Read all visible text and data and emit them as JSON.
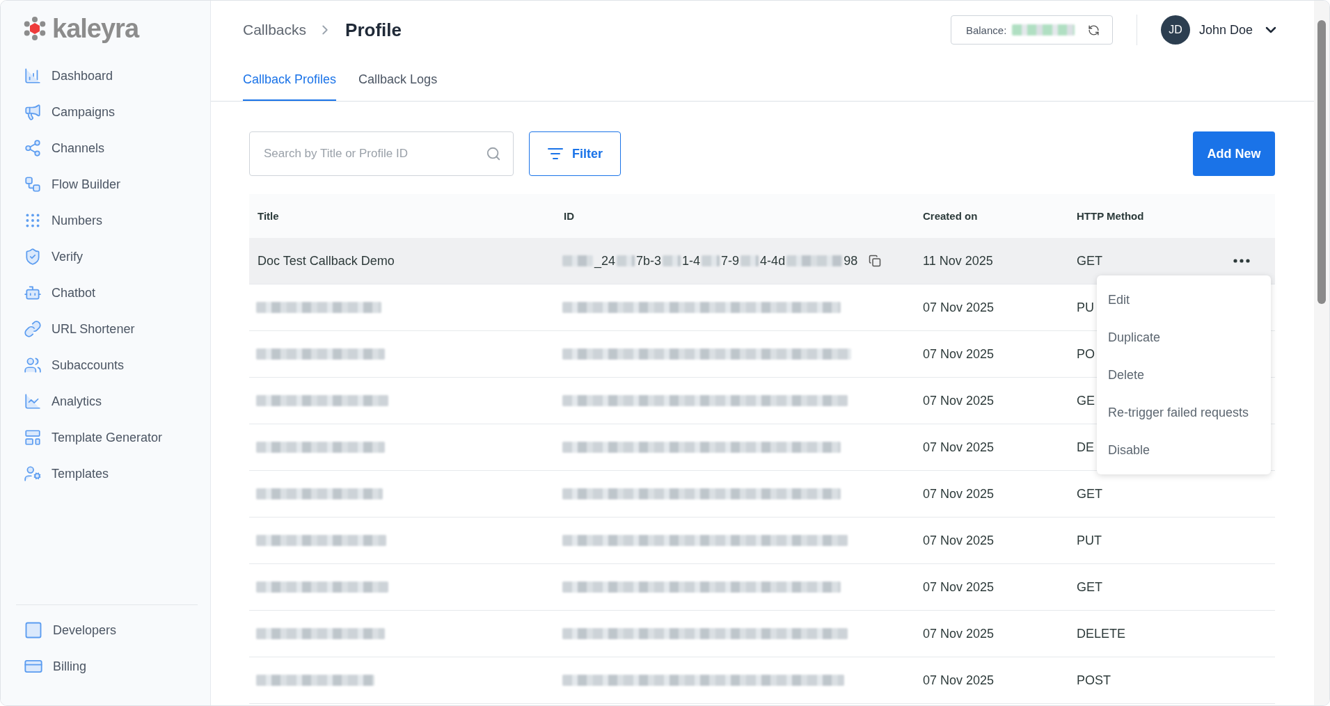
{
  "logo": {
    "text": "kaleyra"
  },
  "sidebar": {
    "items": [
      {
        "label": "Dashboard"
      },
      {
        "label": "Campaigns"
      },
      {
        "label": "Channels"
      },
      {
        "label": "Flow Builder"
      },
      {
        "label": "Numbers"
      },
      {
        "label": "Verify"
      },
      {
        "label": "Chatbot"
      },
      {
        "label": "URL Shortener"
      },
      {
        "label": "Subaccounts"
      },
      {
        "label": "Analytics"
      },
      {
        "label": "Template Generator"
      },
      {
        "label": "Templates"
      }
    ],
    "footer_items": [
      {
        "label": "Developers"
      },
      {
        "label": "Billing"
      }
    ]
  },
  "header": {
    "breadcrumb": [
      "Callbacks",
      "Profile"
    ],
    "balance_label": "Balance:",
    "user": {
      "initials": "JD",
      "name": "John Doe"
    }
  },
  "tabs": [
    {
      "label": "Callback Profiles",
      "selected": true
    },
    {
      "label": "Callback Logs",
      "selected": false
    }
  ],
  "search": {
    "placeholder": "Search by Title or Profile ID"
  },
  "filter_button": "Filter",
  "add_button": "Add New",
  "table": {
    "columns": [
      "Title",
      "ID",
      "Created on",
      "HTTP Method"
    ],
    "rows": [
      {
        "redacted": false,
        "selected": true,
        "menu_open": true,
        "title": "Doc Test Callback Demo",
        "id_parts": [
          "_24",
          "7b-3",
          "1-4",
          "7-9",
          "4-4d",
          "98"
        ],
        "created": "11 Nov 2025",
        "method": "GET"
      },
      {
        "redacted": true,
        "selected": false,
        "menu_open": false,
        "created": "07 Nov 2025",
        "method": "PU"
      },
      {
        "redacted": true,
        "selected": false,
        "menu_open": false,
        "created": "07 Nov 2025",
        "method": "PO"
      },
      {
        "redacted": true,
        "selected": false,
        "menu_open": false,
        "created": "07 Nov 2025",
        "method": "GE"
      },
      {
        "redacted": true,
        "selected": false,
        "menu_open": false,
        "created": "07 Nov 2025",
        "method": "DE"
      },
      {
        "redacted": true,
        "selected": false,
        "menu_open": false,
        "created": "07 Nov 2025",
        "method": "GET"
      },
      {
        "redacted": true,
        "selected": false,
        "menu_open": false,
        "created": "07 Nov 2025",
        "method": "PUT"
      },
      {
        "redacted": true,
        "selected": false,
        "menu_open": false,
        "created": "07 Nov 2025",
        "method": "GET"
      },
      {
        "redacted": true,
        "selected": false,
        "menu_open": false,
        "created": "07 Nov 2025",
        "method": "DELETE"
      },
      {
        "redacted": true,
        "selected": false,
        "menu_open": false,
        "created": "07 Nov 2025",
        "method": "POST"
      }
    ],
    "row_menu": [
      "Edit",
      "Duplicate",
      "Delete",
      "Re-trigger failed requests",
      "Disable"
    ]
  }
}
